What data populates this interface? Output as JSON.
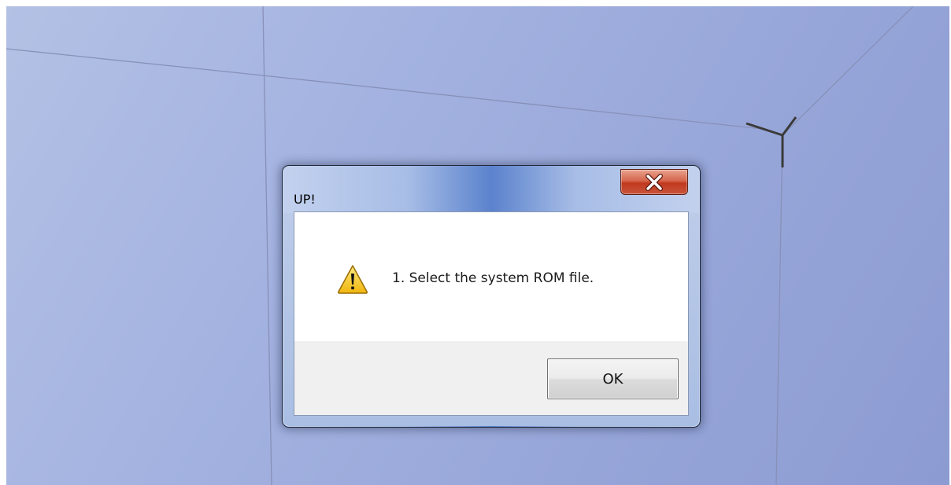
{
  "dialog": {
    "title": "UP!",
    "message": "1. Select the system ROM file.",
    "ok_label": "OK",
    "close_icon": "close-icon",
    "message_icon": "warning-icon"
  },
  "colors": {
    "viewport_background": "#a3b2e0",
    "close_button": "#c9553b",
    "warning_yellow": "#f5c518"
  }
}
